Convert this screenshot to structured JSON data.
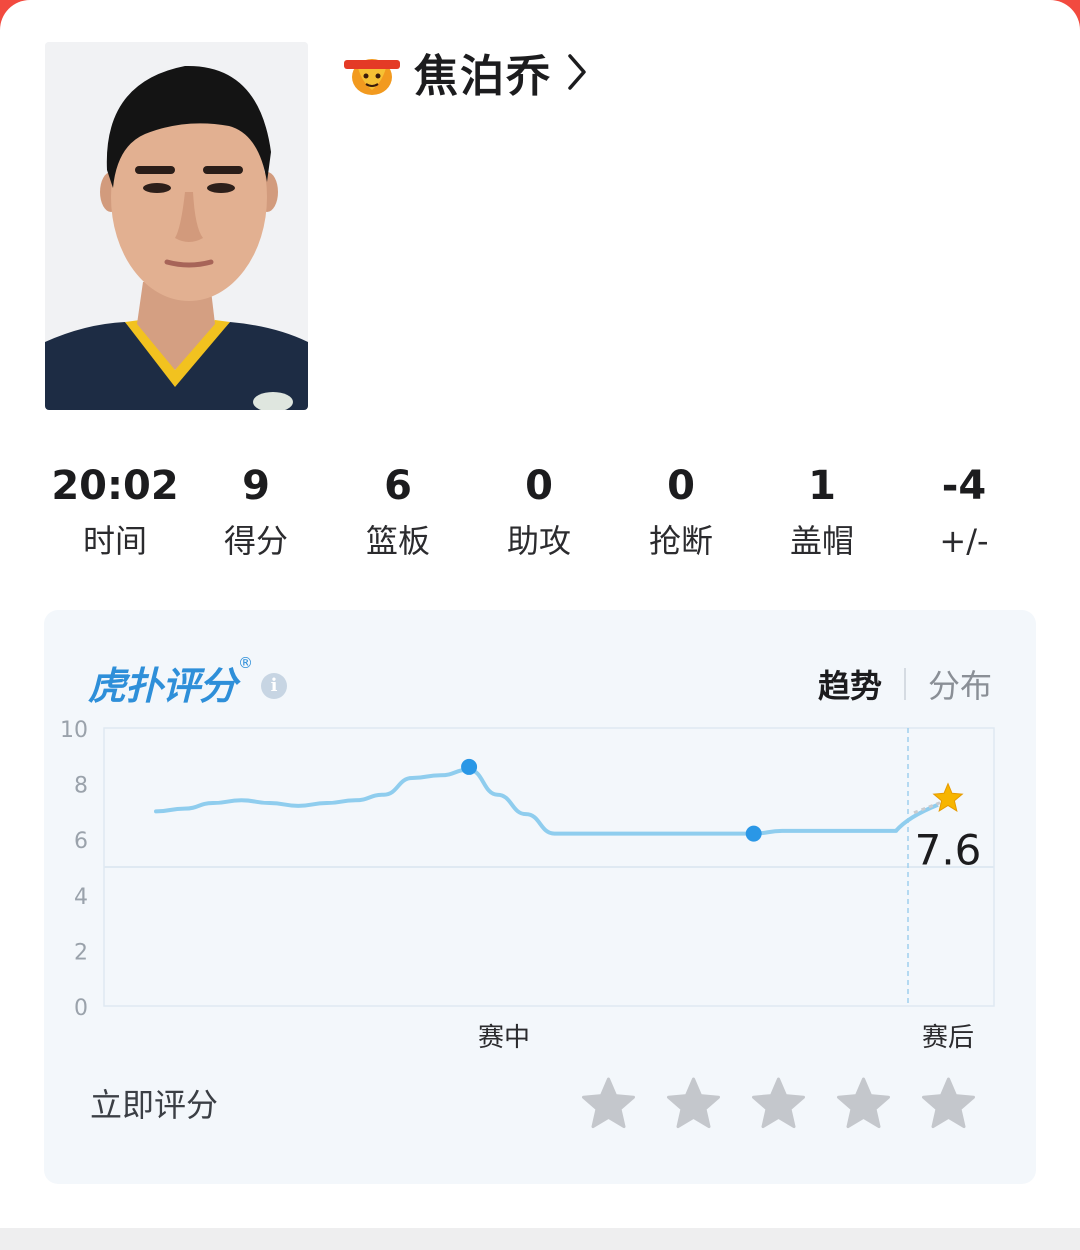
{
  "player": {
    "name": "焦泊乔"
  },
  "stats": [
    {
      "value": "20:02",
      "label": "时间"
    },
    {
      "value": "9",
      "label": "得分"
    },
    {
      "value": "6",
      "label": "篮板"
    },
    {
      "value": "0",
      "label": "助攻"
    },
    {
      "value": "0",
      "label": "抢断"
    },
    {
      "value": "1",
      "label": "盖帽"
    },
    {
      "value": "-4",
      "label": "+/-"
    }
  ],
  "rating": {
    "brand": "虎扑评分",
    "registered_mark": "®",
    "info_icon": "i",
    "tabs": [
      "趋势",
      "分布"
    ],
    "active_tab": "趋势",
    "rate_now_label": "立即评分",
    "star_count": 5,
    "icons": [
      "chevron-right-icon",
      "info-icon",
      "star-icon",
      "team-logo"
    ],
    "colors": {
      "line": "#8fcdee",
      "point": "#2a97e6",
      "star_final": "#f7b500",
      "star_empty": "#c4c7cc",
      "brand": "#2e8fd9"
    }
  },
  "chart_data": {
    "type": "line",
    "yticks": [
      "10",
      "8",
      "6",
      "4",
      "2",
      "0"
    ],
    "ylim": [
      0,
      10
    ],
    "xlabels": [
      "赛中",
      "赛后"
    ],
    "series": [
      {
        "values": [
          7.0,
          7.1,
          7.3,
          7.4,
          7.3,
          7.2,
          7.3,
          7.4,
          7.6,
          8.2,
          8.3,
          8.5,
          7.6,
          6.9,
          6.2,
          6.2,
          6.2,
          6.2,
          6.2,
          6.2,
          6.2,
          6.2,
          6.3,
          6.3,
          6.3,
          6.3,
          6.3
        ]
      }
    ],
    "highlight_points": [
      {
        "x": 11,
        "y": 8.6
      },
      {
        "x": 21,
        "y": 6.2
      }
    ],
    "final_value": "7.6",
    "final_rating": 7.6
  }
}
